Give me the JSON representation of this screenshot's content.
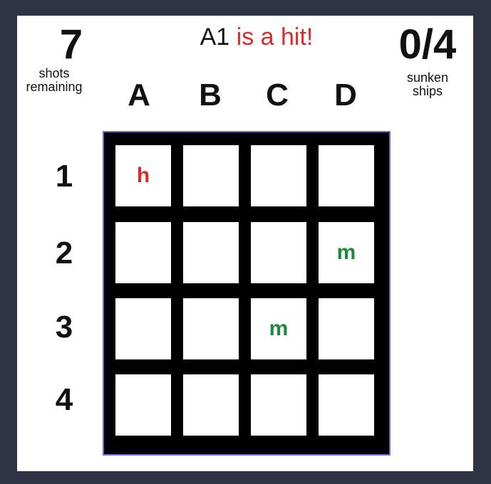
{
  "status": {
    "shots_remaining": "7",
    "shots_label": "shots remaining",
    "sunk_count": "0/4",
    "sunk_label": "sunken ships",
    "message_coord": "A1",
    "message_result": "is a hit!"
  },
  "board": {
    "columns": [
      "A",
      "B",
      "C",
      "D"
    ],
    "rows": [
      "1",
      "2",
      "3",
      "4"
    ],
    "cells": [
      [
        "h",
        "",
        "",
        ""
      ],
      [
        "",
        "",
        "",
        "m"
      ],
      [
        "",
        "",
        "m",
        ""
      ],
      [
        "",
        "",
        "",
        ""
      ]
    ]
  },
  "colors": {
    "hit": "#d92b2b",
    "miss": "#1e8a3e",
    "board_border": "#7b67d6",
    "background": "#2e3441"
  }
}
